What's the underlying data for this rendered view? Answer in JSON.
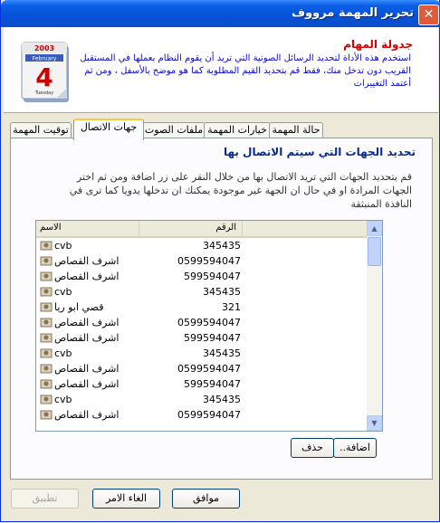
{
  "window": {
    "title": "تحرير المهمة مرووف",
    "close_glyph": "✕"
  },
  "header": {
    "title": "جدولة المهام",
    "description": "استخدم هذه الأداة لتحديد الرسائل الصوتية التي تريد أن يقوم النظام بعملها في المستقبل القريب دون تدخل منك، فقط قم بتحديد القيم المطلوبة كما هو موضح بالأسفل ، ومن ثم أعتمد التغييرات",
    "calendar": {
      "year": "2003",
      "month": "February",
      "day": "4",
      "weekday": "Tuesday"
    }
  },
  "tabs": [
    {
      "label": "توقيت المهمة"
    },
    {
      "label": "جهات الاتصال"
    },
    {
      "label": "ملفات الصوت"
    },
    {
      "label": "خيارات المهمة"
    },
    {
      "label": "حالة المهمة"
    }
  ],
  "panel": {
    "title": "تحديد الجهات التي سيتم الاتصال بها",
    "description": "قم بتحديد الجهات التي تريد الاتصال بها من خلال النقر على زر اضافة ومن ثم اختر الجهات المرادة او في حال ان الجهة غير موجودة يمكنك ان تدخلها يدويا كما ترى في النافذة المنبثقة"
  },
  "list": {
    "columns": {
      "name": "الاسم",
      "number": "الرقم"
    },
    "rows": [
      {
        "name": "cvb",
        "number": "345435"
      },
      {
        "name": "اشرف القصاص",
        "number": "0599594047"
      },
      {
        "name": "اشرف القصاص",
        "number": "599594047"
      },
      {
        "name": "cvb",
        "number": "345435"
      },
      {
        "name": "قصي ابو ريا",
        "number": "321"
      },
      {
        "name": "اشرف القصاص",
        "number": "0599594047"
      },
      {
        "name": "اشرف القصاص",
        "number": "599594047"
      },
      {
        "name": "cvb",
        "number": "345435"
      },
      {
        "name": "اشرف القصاص",
        "number": "0599594047"
      },
      {
        "name": "اشرف القصاص",
        "number": "599594047"
      },
      {
        "name": "cvb",
        "number": "345435"
      },
      {
        "name": "اشرف القصاص",
        "number": "0599594047"
      }
    ]
  },
  "buttons": {
    "add": "اضافة..",
    "delete": "حذف",
    "ok": "موافق",
    "cancel": "الغاء الامر",
    "apply": "تطبيق"
  },
  "colors": {
    "titlebar": "#0551D8",
    "header_title": "#D40000",
    "header_text": "#0A0AD0",
    "panel_title": "#0A2A8C",
    "active_tab_accent": "#FFC83C"
  }
}
